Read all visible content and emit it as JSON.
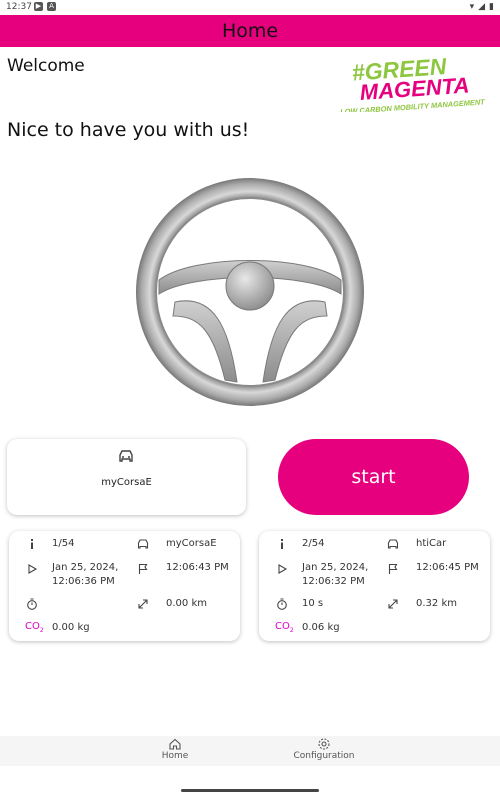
{
  "status": {
    "time": "12:37"
  },
  "appbar": {
    "title": "Home"
  },
  "welcome": "Welcome",
  "greeting": "Nice to have you with us!",
  "logo": {
    "line1": "#GREEN",
    "line2": "MAGENTA",
    "line3": "LOW CARBON MOBILITY MANAGEMENT"
  },
  "car_card": {
    "name": "myCorsaE"
  },
  "start_button": {
    "label": "start"
  },
  "trips": [
    {
      "index": "1/54",
      "car": "myCorsaE",
      "start_date": "Jan 25, 2024,",
      "start_time": "12:06:36 PM",
      "end_time": "12:06:43 PM",
      "duration": "",
      "distance": "0.00 km",
      "co2_label": "CO",
      "co2_sub": "2",
      "co2": "0.00 kg"
    },
    {
      "index": "2/54",
      "car": "htiCar",
      "start_date": "Jan 25, 2024,",
      "start_time": "12:06:32 PM",
      "end_time": "12:06:45 PM",
      "duration": "10 s",
      "distance": "0.32 km",
      "co2_label": "CO",
      "co2_sub": "2",
      "co2": "0.06 kg"
    }
  ],
  "nav": {
    "home": "Home",
    "configuration": "Configuration"
  },
  "colors": {
    "accent": "#e6007e",
    "logo_green": "#8dc63f",
    "co2": "#e000c8"
  }
}
